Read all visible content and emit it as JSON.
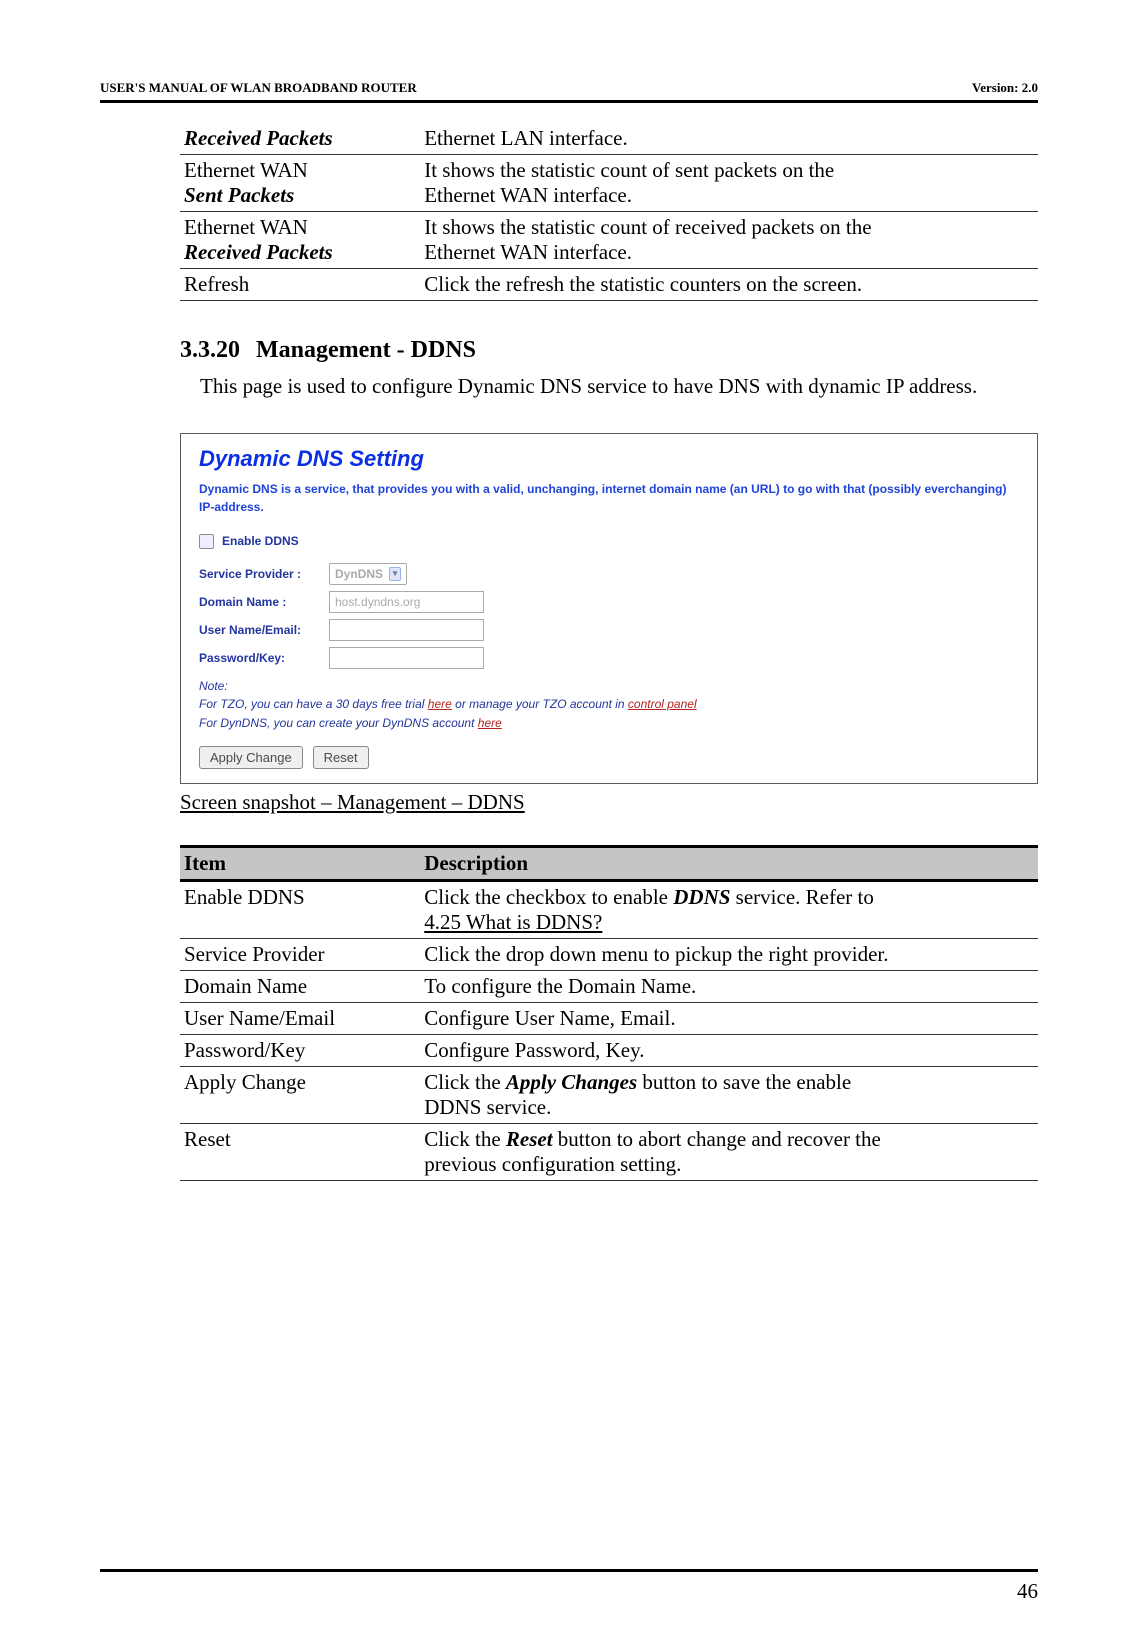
{
  "header": {
    "left": "USER'S MANUAL OF WLAN BROADBAND ROUTER",
    "right": "Version: 2.0"
  },
  "top_table": {
    "rows": [
      {
        "item_html": [
          "",
          "Received Packets"
        ],
        "item_style": "bi",
        "desc": "Ethernet LAN interface."
      },
      {
        "item_html": [
          "Ethernet WAN",
          "Sent Packets"
        ],
        "item_style": "bi-last",
        "desc_lines": [
          "It shows the statistic count of sent packets on the",
          "Ethernet WAN interface."
        ]
      },
      {
        "item_html": [
          "Ethernet WAN",
          "Received Packets"
        ],
        "item_style": "bi-last",
        "desc_lines": [
          "It shows the statistic count of received packets on the",
          "Ethernet WAN interface."
        ]
      },
      {
        "item_html": [
          "Refresh"
        ],
        "item_style": "plain",
        "desc": "Click the refresh the statistic counters on the screen."
      }
    ]
  },
  "section": {
    "number": "3.3.20",
    "title": "Management - DDNS",
    "paragraph": "This page is used to configure Dynamic DNS service to have DNS with dynamic IP address."
  },
  "panel": {
    "title": "Dynamic DNS  Setting",
    "intro": "Dynamic DNS is a service, that provides you with a valid, unchanging, internet domain name (an URL) to go with that (possibly everchanging) IP-address.",
    "enable_label": "Enable DDNS",
    "service_provider_label": "Service Provider :",
    "service_provider_value": "DynDNS",
    "domain_name_label": "Domain Name :",
    "domain_name_value": "host.dyndns.org",
    "user_label": "User Name/Email:",
    "password_label": "Password/Key:",
    "note_heading": "Note:",
    "note_line1_pre": "For TZO, you can have a 30 days free trial ",
    "note_link1": "here",
    "note_line1_mid": " or manage your TZO account in ",
    "note_link2": "control panel",
    "note_line2_pre": "For DynDNS, you can create your DynDNS account ",
    "note_link3": "here",
    "apply_button": "Apply Change",
    "reset_button": "Reset"
  },
  "caption": "Screen snapshot – Management – DDNS",
  "desc_table": {
    "head_item": "Item",
    "head_desc": "Description",
    "rows": [
      {
        "item": "Enable DDNS",
        "desc_parts": [
          {
            "t": "Click the checkbox to enable "
          },
          {
            "t": "DDNS",
            "bi": true
          },
          {
            "t": " service. Refer to "
          },
          {
            "br": true
          },
          {
            "t": "4.25 What is DDNS?",
            "u": true
          }
        ]
      },
      {
        "item": "Service Provider",
        "desc": "Click the drop down menu to pickup the right provider."
      },
      {
        "item": "Domain Name",
        "desc": "To configure the Domain Name."
      },
      {
        "item": "User Name/Email",
        "desc": "Configure User Name, Email."
      },
      {
        "item": "Password/Key",
        "desc": "Configure Password, Key."
      },
      {
        "item": "Apply Change",
        "desc_parts": [
          {
            "t": "Click the "
          },
          {
            "t": "Apply Changes",
            "bi": true
          },
          {
            "t": " button to save the enable "
          },
          {
            "br": true
          },
          {
            "t": "DDNS service."
          }
        ]
      },
      {
        "item": "Reset",
        "desc_parts": [
          {
            "t": "Click the "
          },
          {
            "t": "Reset",
            "bi": true
          },
          {
            "t": " button to abort change and recover the "
          },
          {
            "br": true
          },
          {
            "t": "previous configuration setting."
          }
        ]
      }
    ]
  },
  "page_number": "46"
}
